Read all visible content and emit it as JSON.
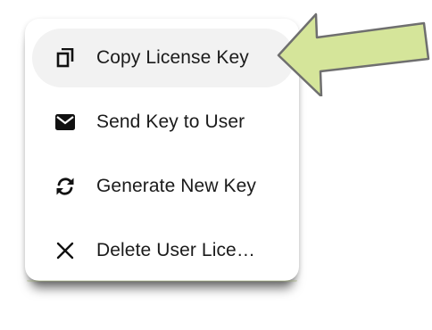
{
  "menu": {
    "items": [
      {
        "label": "Copy License Key",
        "icon": "copy-icon",
        "active": true
      },
      {
        "label": "Send Key to User",
        "icon": "envelope-icon",
        "active": false
      },
      {
        "label": "Generate New Key",
        "icon": "refresh-icon",
        "active": false
      },
      {
        "label": "Delete User Lice…",
        "icon": "close-icon",
        "active": false
      }
    ]
  },
  "annotation": {
    "arrow_color": "#d5e59a",
    "arrow_stroke": "#6f6f6f",
    "points_to": "Copy License Key"
  },
  "colors": {
    "highlight": "#f2f2f2",
    "text": "#1b1b1b"
  }
}
